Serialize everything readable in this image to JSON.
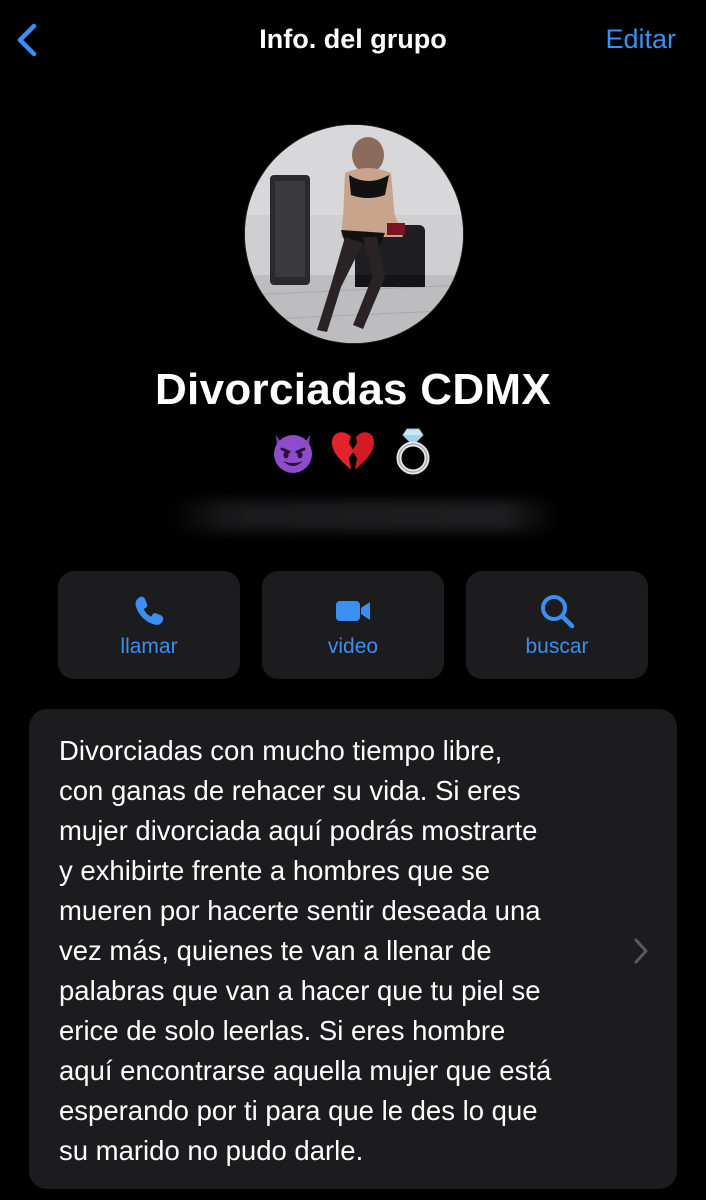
{
  "navbar": {
    "title": "Info. del grupo",
    "edit_label": "Editar",
    "back_icon": "chevron-left-icon",
    "accent": "#3b8ff0"
  },
  "group": {
    "name": "Divorciadas CDMX",
    "emojis": [
      "smiling-face-with-horns-emoji",
      "broken-heart-emoji",
      "ring-emoji"
    ]
  },
  "actions": [
    {
      "label": "llamar",
      "icon": "phone-icon"
    },
    {
      "label": "video",
      "icon": "video-camera-icon"
    },
    {
      "label": "buscar",
      "icon": "search-icon"
    }
  ],
  "description": {
    "text": "Divorciadas con mucho tiempo libre,\ncon ganas de rehacer su vida. Si eres\nmujer divorciada aquí podrás mostrarte\ny exhibirte frente a hombres que se\nmueren por hacerte sentir deseada una\nvez más, quienes te van a llenar de\npalabras que van a hacer que tu piel se\nerice de solo leerlas. Si eres hombre\naquí encontrarse aquella mujer que está\nesperando por ti para que le des lo que\nsu marido no pudo darle.",
    "chevron_icon": "chevron-right-icon"
  },
  "colors": {
    "background": "#000000",
    "card": "#1c1c1e",
    "text": "#ffffff",
    "chevron": "#5a5a5e"
  }
}
